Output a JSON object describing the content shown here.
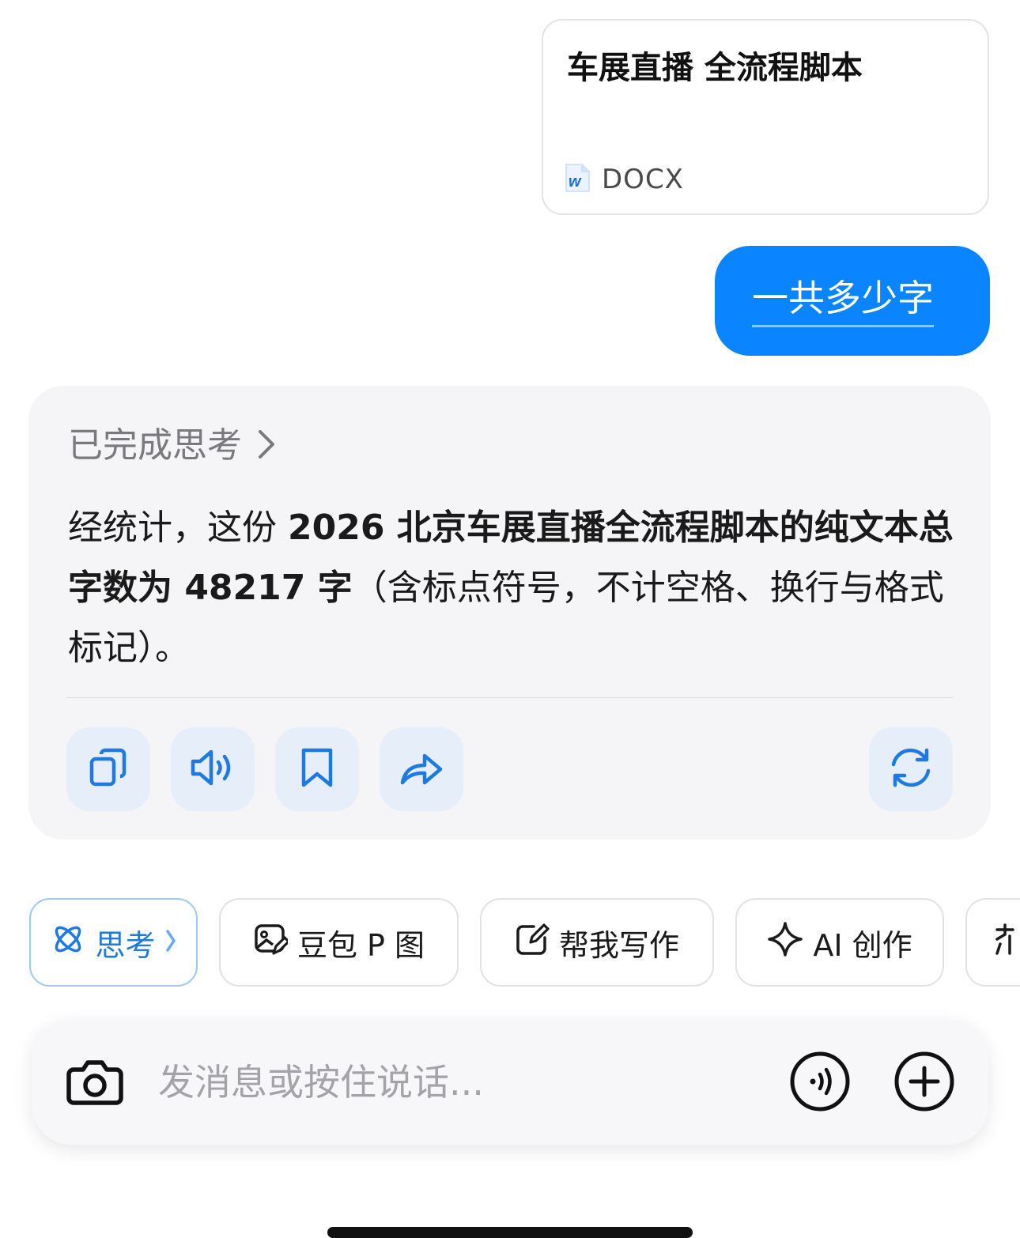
{
  "file_card": {
    "title": "车展直播 全流程脚本",
    "type_label": "DOCX",
    "icon": "word-doc-icon"
  },
  "user_message": {
    "text": "一共多少字"
  },
  "answer": {
    "thinking_label": "已完成思考",
    "text_part1": "经统计，这份 ",
    "text_bold1": "2026 北京车展直播全流程脚本的纯文本总字数为 48217 字",
    "text_part2": "（含标点符号，不计空格、换行与格式标记）。",
    "actions": [
      "copy-icon",
      "speaker-icon",
      "bookmark-icon",
      "share-icon",
      "regenerate-icon"
    ]
  },
  "chips": [
    {
      "label": "思考",
      "icon": "atom-icon",
      "active": true
    },
    {
      "label": "豆包 P 图",
      "icon": "image-edit-icon"
    },
    {
      "label": "帮我写作",
      "icon": "edit-square-icon"
    },
    {
      "label": "AI 创作",
      "icon": "sparkle-icon"
    }
  ],
  "input": {
    "placeholder": "发消息或按住说话..."
  },
  "colors": {
    "accent": "#0a84ff",
    "chip_active": "#1f7ae0",
    "action_icon": "#1f7ae0"
  }
}
